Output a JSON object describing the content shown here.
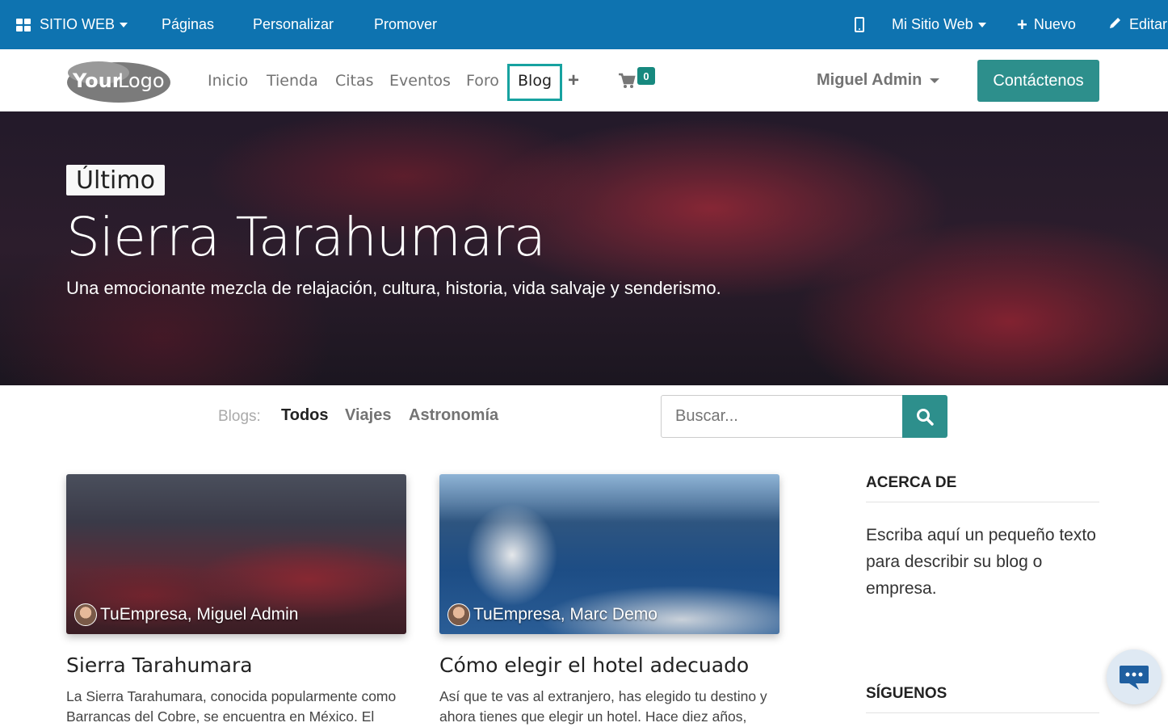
{
  "adminbar": {
    "website_menu": "SITIO WEB",
    "pages": "Páginas",
    "customize": "Personalizar",
    "promote": "Promover",
    "site_selector": "Mi Sitio Web",
    "new": "Nuevo",
    "edit": "Editar"
  },
  "header": {
    "logo_text": "YourLogo",
    "nav": [
      "Inicio",
      "Tienda",
      "Citas",
      "Eventos",
      "Foro",
      "Blog"
    ],
    "cart_count": "0",
    "user": "Miguel Admin",
    "contact_button": "Contáctenos"
  },
  "hero": {
    "badge": "Último",
    "title": "Sierra Tarahumara",
    "subtitle": "Una emocionante mezcla de relajación, cultura, historia, vida salvaje y senderismo."
  },
  "filters": {
    "label": "Blogs:",
    "items": [
      "Todos",
      "Viajes",
      "Astronomía"
    ],
    "search_placeholder": "Buscar..."
  },
  "posts": [
    {
      "author": "TuEmpresa, Miguel Admin",
      "title": "Sierra Tarahumara",
      "excerpt": "La Sierra Tarahumara, conocida popularmente como Barrancas del Cobre, se encuentra en México. El área"
    },
    {
      "author": "TuEmpresa, Marc Demo",
      "title": "Cómo elegir el hotel adecuado",
      "excerpt": "Así que te vas al extranjero, has elegido tu destino y ahora tienes que elegir un hotel. Hace diez años,"
    }
  ],
  "sidebar": {
    "about_heading": "ACERCA DE",
    "about_text": "Escriba aquí un pequeño texto para describir su blog o empresa.",
    "follow_heading": "SÍGUENOS"
  },
  "colors": {
    "adminbar": "#0e73b0",
    "accent": "#2d8f8c",
    "active_nav_border": "#17a2a0"
  }
}
